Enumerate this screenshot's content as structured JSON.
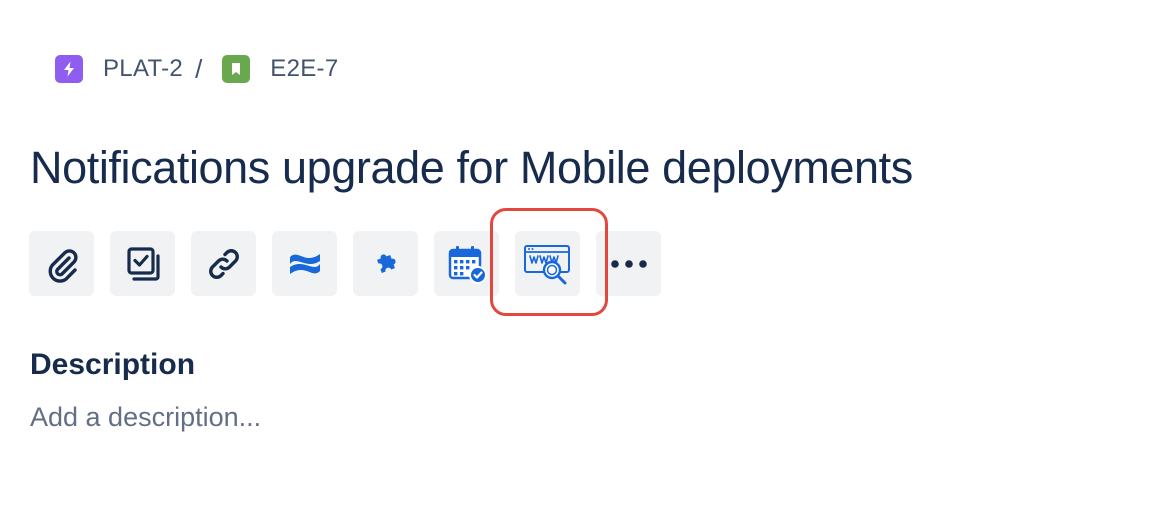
{
  "breadcrumb": {
    "parent": {
      "key": "PLAT-2",
      "icon": "lightning-icon",
      "color": "#8f5df0"
    },
    "separator": "/",
    "current": {
      "key": "E2E-7",
      "icon": "bookmark-icon",
      "color": "#6aa84f"
    }
  },
  "issue": {
    "title": "Notifications upgrade for Mobile deployments"
  },
  "toolbar": {
    "buttons": [
      {
        "name": "attach",
        "icon": "paperclip-icon"
      },
      {
        "name": "add-child-issue",
        "icon": "child-issues-icon"
      },
      {
        "name": "link-issue",
        "icon": "link-icon"
      },
      {
        "name": "confluence",
        "icon": "confluence-icon",
        "color": "#1868db"
      },
      {
        "name": "apps",
        "icon": "puzzle-icon",
        "color": "#1868db"
      },
      {
        "name": "calendar-app",
        "icon": "calendar-check-icon",
        "color": "#1868db"
      },
      {
        "name": "web-search-app",
        "icon": "web-search-icon",
        "color": "#1868db"
      },
      {
        "name": "more-actions",
        "icon": "more-icon"
      }
    ],
    "highlight_color": "#e2483d"
  },
  "description": {
    "heading": "Description",
    "placeholder": "Add a description..."
  }
}
